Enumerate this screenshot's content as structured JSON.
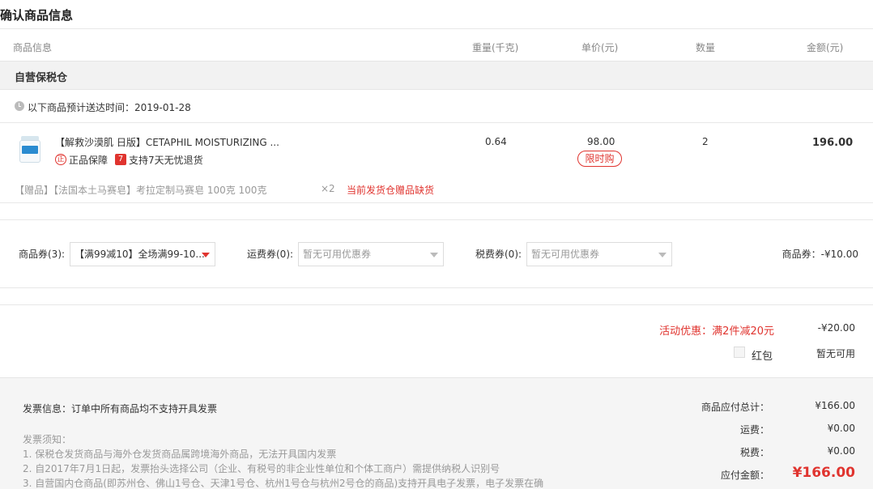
{
  "title": "确认商品信息",
  "columns": {
    "info": "商品信息",
    "weight": "重量(千克)",
    "price": "单价(元)",
    "qty": "数量",
    "amount": "金额(元)"
  },
  "warehouse": "自营保税仓",
  "delivery": {
    "label": "以下商品预计送达时间：2019-01-28"
  },
  "product": {
    "name": "【解救沙漠肌 日版】CETAPHIL MOISTURIZING ...",
    "guarantee_badge": "正",
    "guarantee": "正品保障",
    "return_badge": "7",
    "return_policy": "支持7天无忧退货",
    "weight": "0.64",
    "price": "98.00",
    "price_tag": "限时购",
    "qty": "2",
    "amount": "196.00"
  },
  "gift": {
    "text": "【赠品】【法国本土马赛皂】考拉定制马赛皂 100克 100克",
    "qty": "×2",
    "status": "当前发货仓赠品缺货"
  },
  "coupons": {
    "goods_label": "商品券(3):",
    "goods_value": "【满99减10】全场满99-10...",
    "shipping_label": "运费券(0):",
    "shipping_value": "暂无可用优惠券",
    "tax_label": "税费券(0):",
    "tax_value": "暂无可用优惠券",
    "discount": "商品券：-¥10.00"
  },
  "promotion": {
    "label": "活动优惠：满2件减20元",
    "value": "-¥20.00"
  },
  "redpacket": {
    "label": "红包",
    "status": "暂无可用"
  },
  "invoice": {
    "info": "发票信息：订单中所有商品均不支持开具发票",
    "notice_title": "发票须知：",
    "notes": [
      "1. 保税仓发货商品与海外仓发货商品属跨境海外商品，无法开具国内发票",
      "2. 自2017年7月1日起，发票抬头选择公司（企业、有税号的非企业性单位和个体工商户）需提供纳税人识别号",
      "3. 自营国内仓商品(即苏州仓、佛山1号仓、天津1号仓、杭州1号仓与杭州2号仓的商品)支持开具电子发票，电子发票在确"
    ]
  },
  "summary": {
    "goods_total_label": "商品应付总计：",
    "goods_total": "¥166.00",
    "shipping_label": "运费：",
    "shipping": "¥0.00",
    "tax_label": "税费：",
    "tax": "¥0.00",
    "payable_label": "应付金额：",
    "payable": "¥166.00"
  },
  "colors": {
    "accent": "#e0342f"
  }
}
